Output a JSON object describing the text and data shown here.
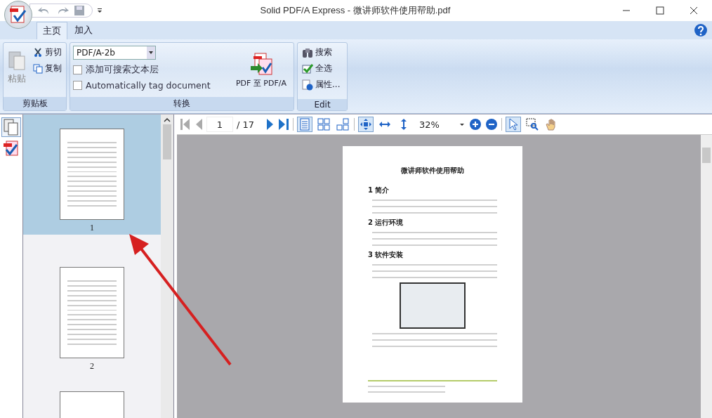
{
  "window": {
    "title": "Solid PDF/A Express - 微讲师软件使用帮助.pdf"
  },
  "tabs": [
    {
      "label": "主页",
      "selected": true
    },
    {
      "label": "加入",
      "selected": false
    }
  ],
  "ribbon": {
    "clipboard": {
      "label": "剪贴板",
      "paste": "粘贴",
      "cut": "剪切",
      "copy": "复制"
    },
    "convert": {
      "label": "转换",
      "format": "PDF/A-2b",
      "options": [
        {
          "label": "添加可搜索文本层",
          "checked": false
        },
        {
          "label": "Automatically tag document",
          "checked": false
        }
      ],
      "button": "PDF 至 PDF/A"
    },
    "edit": {
      "label": "Edit",
      "items": [
        {
          "kind": "search",
          "label": "搜索"
        },
        {
          "kind": "selectall",
          "label": "全选"
        },
        {
          "kind": "properties",
          "label": "属性..."
        }
      ]
    }
  },
  "side_tabs": [
    {
      "kind": "pages",
      "selected": true
    },
    {
      "kind": "pdfa",
      "selected": false
    }
  ],
  "thumbnails": [
    {
      "label": "1",
      "selected": true
    },
    {
      "label": "2",
      "selected": false
    }
  ],
  "viewer": {
    "page": "1",
    "total": "/ 17",
    "zoom": "32%",
    "layouts": [
      {
        "kind": "single",
        "selected": true
      },
      {
        "kind": "continuous",
        "selected": false
      },
      {
        "kind": "facing",
        "selected": false
      }
    ],
    "fits": [
      {
        "kind": "page",
        "selected": true
      },
      {
        "kind": "width",
        "selected": false
      },
      {
        "kind": "height",
        "selected": false
      }
    ],
    "tools": [
      {
        "kind": "select",
        "selected": true
      },
      {
        "kind": "snapshot",
        "selected": false
      },
      {
        "kind": "hand",
        "selected": false
      }
    ]
  },
  "document": {
    "title": "微讲师软件使用帮助",
    "headings": [
      "1 简介",
      "2 运行环境",
      "3 软件安装"
    ]
  }
}
